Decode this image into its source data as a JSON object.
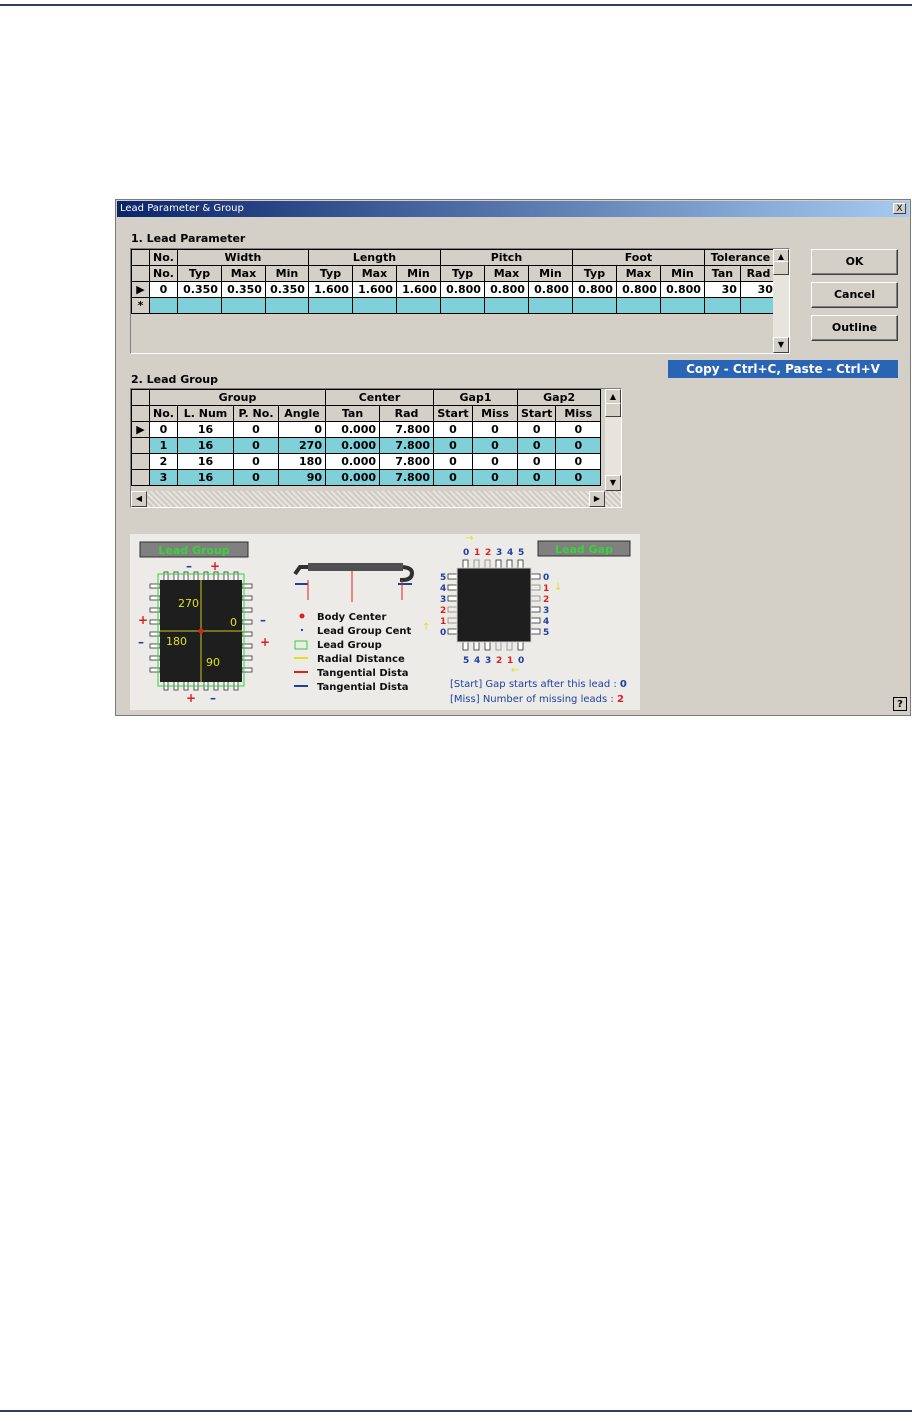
{
  "dialog": {
    "title": "Lead Parameter & Group",
    "close_label": "X",
    "help_label": "?"
  },
  "section1": {
    "label": "1. Lead Parameter"
  },
  "section2": {
    "label": "2. Lead Group"
  },
  "param_grid": {
    "group_headers": [
      "No.",
      "Width",
      "Length",
      "Pitch",
      "Foot",
      "Tolerance"
    ],
    "sub_headers": [
      "No.",
      "Typ",
      "Max",
      "Min",
      "Typ",
      "Max",
      "Min",
      "Typ",
      "Max",
      "Min",
      "Typ",
      "Max",
      "Min",
      "Tan",
      "Rad"
    ],
    "rows": [
      {
        "no": "0",
        "cells": [
          "0.350",
          "0.350",
          "0.350",
          "1.600",
          "1.600",
          "1.600",
          "0.800",
          "0.800",
          "0.800",
          "0.800",
          "0.800",
          "0.800",
          "30",
          "30"
        ]
      }
    ],
    "new_row_marker": "*"
  },
  "group_grid": {
    "group_headers": [
      "Group",
      "Center",
      "Gap1",
      "Gap2"
    ],
    "sub_headers": [
      "No.",
      "L. Num",
      "P. No.",
      "Angle",
      "Tan",
      "Rad",
      "Start",
      "Miss",
      "Start",
      "Miss"
    ],
    "rows": [
      {
        "no": "0",
        "cells": [
          "16",
          "0",
          "0",
          "0.000",
          "7.800",
          "0",
          "0",
          "0",
          "0"
        ]
      },
      {
        "no": "1",
        "cells": [
          "16",
          "0",
          "270",
          "0.000",
          "7.800",
          "0",
          "0",
          "0",
          "0"
        ]
      },
      {
        "no": "2",
        "cells": [
          "16",
          "0",
          "180",
          "0.000",
          "7.800",
          "0",
          "0",
          "0",
          "0"
        ]
      },
      {
        "no": "3",
        "cells": [
          "16",
          "0",
          "90",
          "0.000",
          "7.800",
          "0",
          "0",
          "0",
          "0"
        ]
      }
    ]
  },
  "buttons": {
    "ok": "OK",
    "cancel": "Cancel",
    "outline": "Outline"
  },
  "copy_hint": "Copy - Ctrl+C, Paste - Ctrl+V",
  "diagram": {
    "lead_group_title": "Lead Group",
    "lead_gap_title": "Lead Gap",
    "angles": [
      "270",
      "0",
      "180",
      "90"
    ],
    "legend": [
      "Body Center",
      "Lead Group Cent",
      "Lead Group",
      "Radial Distance",
      "Tangential Dista",
      "Tangential Dista"
    ],
    "gap_top": [
      "0",
      "1",
      "2",
      "3",
      "4",
      "5"
    ],
    "gap_bottom": [
      "5",
      "4",
      "3",
      "2",
      "1",
      "0"
    ],
    "gap_left": [
      "5",
      "4",
      "3",
      "2",
      "1",
      "0"
    ],
    "gap_right": [
      "0",
      "1",
      "2",
      "3",
      "4",
      "5"
    ],
    "start_tag": "[Start]",
    "start_text": "Gap starts after this lead :",
    "start_value": "0",
    "miss_tag": "[Miss]",
    "miss_text": "Number of missing leads :",
    "miss_value": "2",
    "plus": "+",
    "minus": "–"
  },
  "colors": {
    "cyan_row": "#7fd0d8",
    "banner": "#2a64b4",
    "title_green": "#38d238",
    "gap_blue": "#2040a0",
    "gap_red": "#e02020"
  }
}
